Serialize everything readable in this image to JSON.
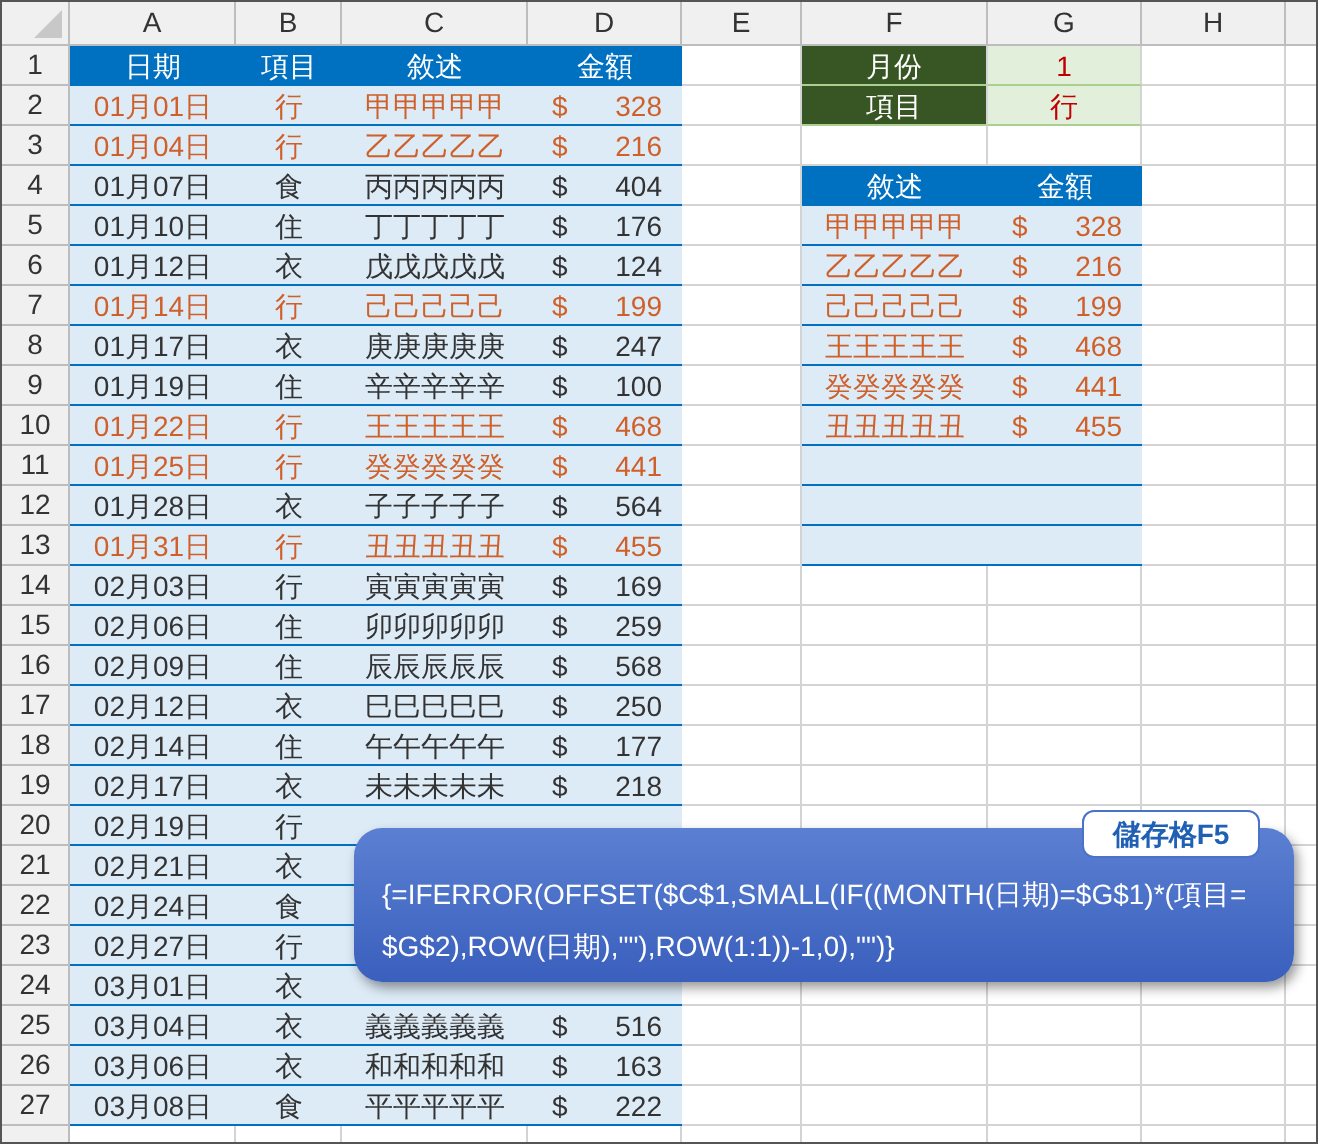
{
  "columns": [
    "A",
    "B",
    "C",
    "D",
    "E",
    "F",
    "G",
    "H"
  ],
  "row_numbers": [
    "1",
    "2",
    "3",
    "4",
    "5",
    "6",
    "7",
    "8",
    "9",
    "10",
    "11",
    "12",
    "13",
    "14",
    "15",
    "16",
    "17",
    "18",
    "19",
    "20",
    "21",
    "22",
    "23",
    "24",
    "25",
    "26",
    "27"
  ],
  "table": {
    "headers": [
      "日期",
      "項目",
      "敘述",
      "金額"
    ],
    "rows": [
      {
        "date": "01月01日",
        "item": "行",
        "desc": "甲甲甲甲甲",
        "currency": "$",
        "amount": "328",
        "highlighted": true
      },
      {
        "date": "01月04日",
        "item": "行",
        "desc": "乙乙乙乙乙",
        "currency": "$",
        "amount": "216",
        "highlighted": true
      },
      {
        "date": "01月07日",
        "item": "食",
        "desc": "丙丙丙丙丙",
        "currency": "$",
        "amount": "404",
        "highlighted": false
      },
      {
        "date": "01月10日",
        "item": "住",
        "desc": "丁丁丁丁丁",
        "currency": "$",
        "amount": "176",
        "highlighted": false
      },
      {
        "date": "01月12日",
        "item": "衣",
        "desc": "戊戊戊戊戊",
        "currency": "$",
        "amount": "124",
        "highlighted": false
      },
      {
        "date": "01月14日",
        "item": "行",
        "desc": "己己己己己",
        "currency": "$",
        "amount": "199",
        "highlighted": true
      },
      {
        "date": "01月17日",
        "item": "衣",
        "desc": "庚庚庚庚庚",
        "currency": "$",
        "amount": "247",
        "highlighted": false
      },
      {
        "date": "01月19日",
        "item": "住",
        "desc": "辛辛辛辛辛",
        "currency": "$",
        "amount": "100",
        "highlighted": false
      },
      {
        "date": "01月22日",
        "item": "行",
        "desc": "王王王王王",
        "currency": "$",
        "amount": "468",
        "highlighted": true
      },
      {
        "date": "01月25日",
        "item": "行",
        "desc": "癸癸癸癸癸",
        "currency": "$",
        "amount": "441",
        "highlighted": true
      },
      {
        "date": "01月28日",
        "item": "衣",
        "desc": "子子子子子",
        "currency": "$",
        "amount": "564",
        "highlighted": false
      },
      {
        "date": "01月31日",
        "item": "行",
        "desc": "丑丑丑丑丑",
        "currency": "$",
        "amount": "455",
        "highlighted": true
      },
      {
        "date": "02月03日",
        "item": "行",
        "desc": "寅寅寅寅寅",
        "currency": "$",
        "amount": "169",
        "highlighted": false
      },
      {
        "date": "02月06日",
        "item": "住",
        "desc": "卯卯卯卯卯",
        "currency": "$",
        "amount": "259",
        "highlighted": false
      },
      {
        "date": "02月09日",
        "item": "住",
        "desc": "辰辰辰辰辰",
        "currency": "$",
        "amount": "568",
        "highlighted": false
      },
      {
        "date": "02月12日",
        "item": "衣",
        "desc": "巳巳巳巳巳",
        "currency": "$",
        "amount": "250",
        "highlighted": false
      },
      {
        "date": "02月14日",
        "item": "住",
        "desc": "午午午午午",
        "currency": "$",
        "amount": "177",
        "highlighted": false
      },
      {
        "date": "02月17日",
        "item": "衣",
        "desc": "未未未未未",
        "currency": "$",
        "amount": "218",
        "highlighted": false
      },
      {
        "date": "02月19日",
        "item": "行",
        "highlighted": false
      },
      {
        "date": "02月21日",
        "item": "衣",
        "highlighted": false
      },
      {
        "date": "02月24日",
        "item": "食",
        "highlighted": false
      },
      {
        "date": "02月27日",
        "item": "行",
        "highlighted": false
      },
      {
        "date": "03月01日",
        "item": "衣",
        "highlighted": false
      },
      {
        "date": "03月04日",
        "item": "衣",
        "desc": "義義義義義",
        "currency": "$",
        "amount": "516",
        "highlighted": false
      },
      {
        "date": "03月06日",
        "item": "衣",
        "desc": "和和和和和",
        "currency": "$",
        "amount": "163",
        "highlighted": false
      },
      {
        "date": "03月08日",
        "item": "食",
        "desc": "平平平平平",
        "currency": "$",
        "amount": "222",
        "highlighted": false
      }
    ]
  },
  "criteria": [
    {
      "label": "月份",
      "value": "1"
    },
    {
      "label": "項目",
      "value": "行"
    }
  ],
  "result": {
    "headers": [
      "敘述",
      "金額"
    ],
    "rows": [
      {
        "desc": "甲甲甲甲甲",
        "currency": "$",
        "amount": "328"
      },
      {
        "desc": "乙乙乙乙乙",
        "currency": "$",
        "amount": "216"
      },
      {
        "desc": "己己己己己",
        "currency": "$",
        "amount": "199"
      },
      {
        "desc": "王王王王王",
        "currency": "$",
        "amount": "468"
      },
      {
        "desc": "癸癸癸癸癸",
        "currency": "$",
        "amount": "441"
      },
      {
        "desc": "丑丑丑丑丑",
        "currency": "$",
        "amount": "455"
      }
    ]
  },
  "callout": {
    "label": "儲存格F5",
    "formula": "{=IFERROR(OFFSET($C$1,SMALL(IF((MONTH(日期)=$G$1)*(項目=$G$2),ROW(日期),\"\"),ROW(1:1))-1,0),\"\")}"
  }
}
